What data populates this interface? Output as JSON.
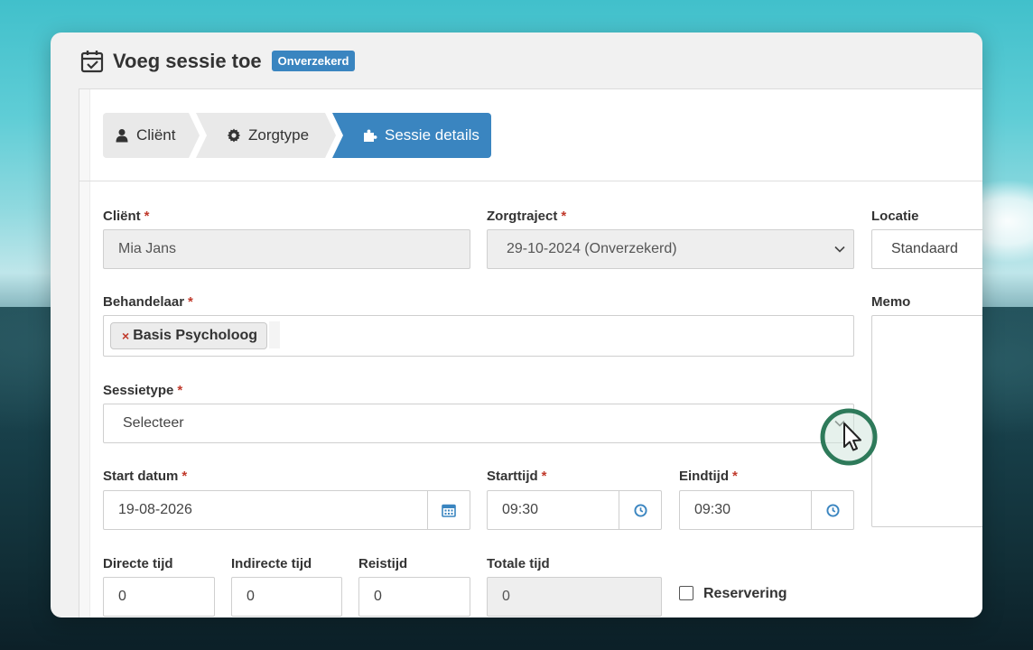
{
  "dialog": {
    "title": "Voeg sessie toe",
    "badge": "Onverzekerd"
  },
  "wizard": {
    "steps": [
      {
        "label": "Cliënt",
        "icon": "user-icon",
        "active": false
      },
      {
        "label": "Zorgtype",
        "icon": "gear-icon",
        "active": false
      },
      {
        "label": "Sessie details",
        "icon": "puzzle-icon",
        "active": true
      }
    ]
  },
  "form": {
    "client": {
      "label": "Cliënt",
      "required": "*",
      "value": "Mia Jans"
    },
    "zorgtraject": {
      "label": "Zorgtraject",
      "required": "*",
      "value": "29-10-2024 (Onverzekerd)"
    },
    "locatie": {
      "label": "Locatie",
      "value": "Standaard"
    },
    "behandelaar": {
      "label": "Behandelaar",
      "required": "*",
      "tag_remove": "×",
      "tag": "Basis Psycholoog"
    },
    "memo": {
      "label": "Memo",
      "value": ""
    },
    "sessietype": {
      "label": "Sessietype",
      "required": "*",
      "value": "Selecteer"
    },
    "start_datum": {
      "label": "Start datum",
      "required": "*",
      "value": "19-08-2026"
    },
    "starttijd": {
      "label": "Starttijd",
      "required": "*",
      "value": "09:30"
    },
    "eindtijd": {
      "label": "Eindtijd",
      "required": "*",
      "value": "09:30"
    },
    "directe_tijd": {
      "label": "Directe tijd",
      "value": "0"
    },
    "indirecte_tijd": {
      "label": "Indirecte tijd",
      "value": "0"
    },
    "reistijd": {
      "label": "Reistijd",
      "value": "0"
    },
    "totale_tijd": {
      "label": "Totale tijd",
      "value": "0"
    },
    "reservering": {
      "label": "Reservering",
      "checked": false
    }
  },
  "colors": {
    "accent": "#3a85c0",
    "required": "#c0392b",
    "cursor_ring": "#2e7a5a"
  }
}
